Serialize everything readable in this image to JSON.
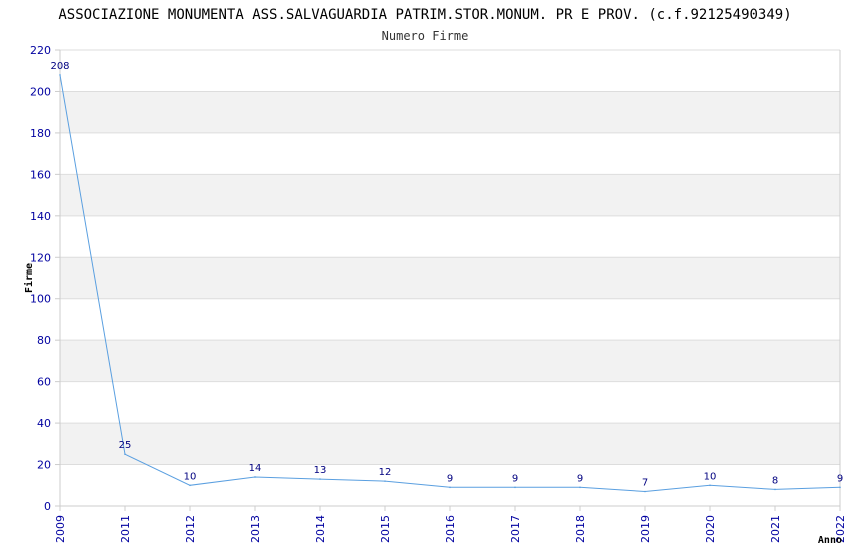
{
  "colors": {
    "band_fill": "#f2f2f2",
    "plot_fill": "#ffffff",
    "grid_line": "#dddddd",
    "axis_line": "#cccccc",
    "series_line": "#5a9fe0",
    "tick_label": "#0000a0",
    "data_label": "#000080"
  },
  "chart_data": {
    "type": "line",
    "title": "ASSOCIAZIONE MONUMENTA ASS.SALVAGUARDIA PATRIM.STOR.MONUM. PR E PROV. (c.f.92125490349)",
    "subtitle": "Numero Firme",
    "xlabel": "Anno",
    "ylabel": "Firme",
    "categories": [
      "2009",
      "2011",
      "2012",
      "2013",
      "2014",
      "2015",
      "2016",
      "2017",
      "2018",
      "2019",
      "2020",
      "2021",
      "2022"
    ],
    "values": [
      208,
      25,
      10,
      14,
      13,
      12,
      9,
      9,
      9,
      7,
      10,
      8,
      9
    ],
    "ylim": [
      0,
      220
    ],
    "yticks": [
      0,
      20,
      40,
      60,
      80,
      100,
      120,
      140,
      160,
      180,
      200,
      220
    ],
    "grid": true,
    "alternating_bands": true,
    "legend": "none"
  }
}
